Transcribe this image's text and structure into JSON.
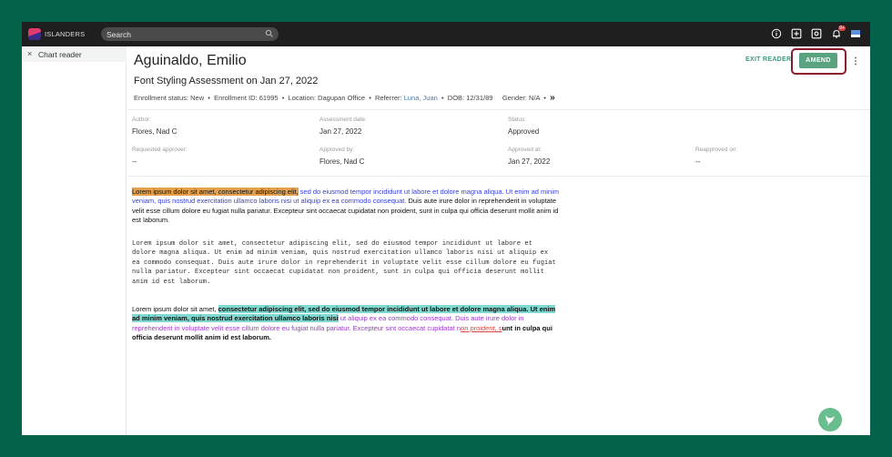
{
  "app": {
    "brand": "ISLANDERS",
    "search_placeholder": "Search",
    "notification_count": "9+"
  },
  "sidebar": {
    "close_glyph": "×",
    "tab_label": "Chart reader"
  },
  "header": {
    "patient_name": "Aguinaldo, Emilio",
    "assessment_title": "Font Styling Assessment on Jan 27, 2022",
    "meta": {
      "enrollment_status": "Enrollment status: New",
      "enrollment_id": "Enrollment ID: 61995",
      "location": "Location: Dagupan Office",
      "referrer_label": "Referrer:",
      "referrer_name": "Luna, Juan",
      "dob": "DOB: 12/31/89",
      "gender": "Gender: N/A",
      "more": "»"
    },
    "exit_reader_label": "EXIT READER",
    "amend_label": "AMEND"
  },
  "details": {
    "author_label": "Author:",
    "author_value": "Flores, Nad C",
    "assessment_date_label": "Assessment date:",
    "assessment_date_value": "Jan 27, 2022",
    "status_label": "Status:",
    "status_value": "Approved",
    "requested_approver_label": "Requested approver:",
    "requested_approver_value": "--",
    "approved_by_label": "Approved by:",
    "approved_by_value": "Flores, Nad C",
    "approved_at_label": "Approved at:",
    "approved_at_value": "Jan 27, 2022",
    "reapproved_on_label": "Reapproved on:",
    "reapproved_on_value": "--"
  },
  "body": {
    "p1_highlight": "Lorem ipsum dolor sit amet, consectetur adipiscing elit,",
    "p1_blue": " sed do eiusmod tempor incididunt ut labore et dolore magna aliqua. Ut enim ad minim veniam, quis nostrud exercitation ullamco laboris nisi ut aliquip ex ea commodo consequat.",
    "p1_black": " Duis aute irure dolor in reprehenderit in voluptate velit esse cillum dolore eu fugiat nulla pariatur. Excepteur sint occaecat cupidatat non proident, sunt in culpa qui officia deserunt mollit anim id est laborum.",
    "p2_mono": "Lorem ipsum dolor sit amet, consectetur adipiscing elit, sed do eiusmod tempor incididunt ut labore et dolore magna aliqua. Ut enim ad minim veniam, quis nostrud exercitation ullamco laboris nisi ut aliquip ex ea commodo consequat. Duis aute irure dolor in reprehenderit in voluptate velit esse cillum dolore eu fugiat nulla pariatur. Excepteur sint occaecat cupidatat non proident, sunt in culpa qui officia deserunt mollit anim id est laborum.",
    "p3_plain": "Lorem ipsum dolor sit amet, ",
    "p3_teal": "consectetur adipiscing elit, sed do eiusmod tempor incididunt ut labore et dolore magna aliqua. Ut enim ad minim veniam, quis nostrud exercitation ullamco laboris nisi",
    "p3_purple": " ut aliquip ex ea commodo consequat. Duis aute irure dolor in reprehenderit in voluptate velit esse cillum dolore eu fugiat nulla pariatur. Excepteur sint occaecat cupidatat n",
    "p3_red": "on proident, s",
    "p3_end": "unt in culpa qui officia deserunt mollit anim id est laborum."
  },
  "colors": {
    "page_background": "#03634a",
    "topbar": "#1f1f1f",
    "accent_green": "#5aa380",
    "highlight_outline": "#8b1a2a",
    "link_blue": "#3b7dc4"
  },
  "icons": {
    "search": "search-icon",
    "info": "info-icon",
    "add": "add-square-icon",
    "settings": "gear-icon",
    "notifications": "bell-icon",
    "inbox": "inbox-icon",
    "more": "kebab-menu-icon",
    "help": "help-bird-icon"
  }
}
